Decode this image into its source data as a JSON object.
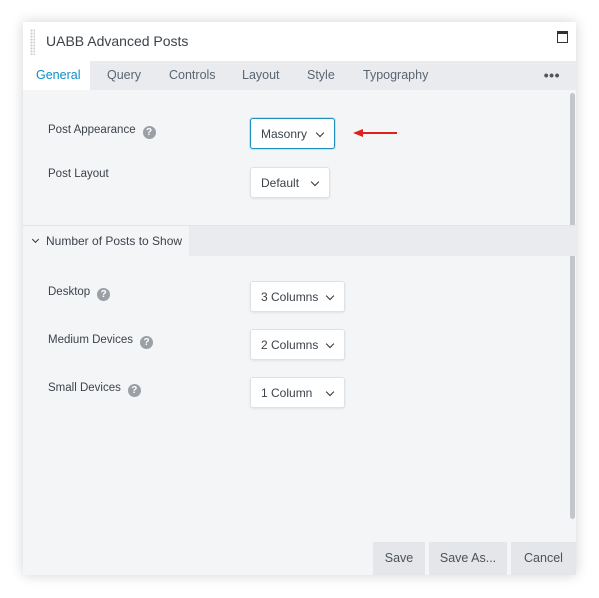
{
  "window": {
    "title": "UABB Advanced Posts"
  },
  "tabs": [
    {
      "label": "General",
      "active": true
    },
    {
      "label": "Query"
    },
    {
      "label": "Controls"
    },
    {
      "label": "Layout"
    },
    {
      "label": "Style"
    },
    {
      "label": "Typography"
    }
  ],
  "more_label": "•••",
  "general": {
    "post_appearance": {
      "label": "Post Appearance",
      "value": "Masonry"
    },
    "post_layout": {
      "label": "Post Layout",
      "value": "Default"
    }
  },
  "section": {
    "title": "Number of Posts to Show",
    "desktop": {
      "label": "Desktop",
      "value": "3 Columns"
    },
    "medium": {
      "label": "Medium Devices",
      "value": "2 Columns"
    },
    "small": {
      "label": "Small Devices",
      "value": "1 Column"
    }
  },
  "help_glyph": "?",
  "footer": {
    "save": "Save",
    "save_as": "Save As...",
    "cancel": "Cancel"
  },
  "colors": {
    "accent": "#0d8fc4",
    "annotation_arrow": "#e0201d"
  }
}
